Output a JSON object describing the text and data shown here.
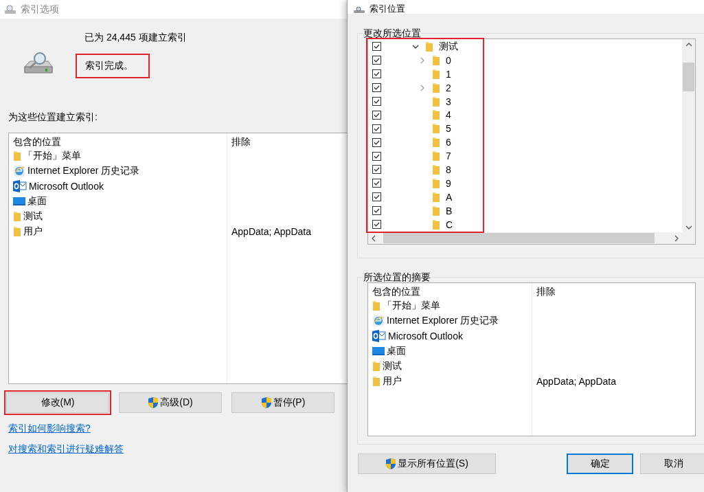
{
  "left_window": {
    "title": "索引选项",
    "indexed_count": "已为 24,445 项建立索引",
    "status": {
      "text": "索引完成。",
      "highlighted": true
    },
    "locations_label": "为这些位置建立索引:",
    "table": {
      "columns": [
        "包含的位置",
        "排除"
      ],
      "rows": [
        {
          "kind": "folder",
          "location": "「开始」菜单"
        },
        {
          "kind": "browser",
          "location": "Internet Explorer 历史记录"
        },
        {
          "kind": "mail",
          "location": "Microsoft Outlook"
        },
        {
          "kind": "desktop",
          "location": "桌面"
        },
        {
          "kind": "folder",
          "location": "测试"
        },
        {
          "kind": "folder",
          "location": "用户",
          "exclude": "AppData; AppData"
        }
      ]
    },
    "buttons": [
      {
        "label": "修改(M)",
        "shield": false,
        "highlighted": true
      },
      {
        "label": "高级(D)",
        "shield": true,
        "highlighted": false
      },
      {
        "label": "暂停(P)",
        "shield": true,
        "highlighted": false
      }
    ],
    "links": [
      "索引如何影响搜索?",
      "对搜索和索引进行疑难解答"
    ]
  },
  "right_window": {
    "title": "索引位置",
    "change_group": {
      "title": "更改所选位置",
      "highlighted": true,
      "tree": [
        {
          "label": "测试",
          "checked": true,
          "expandable": true,
          "expanded": true,
          "children": [
            {
              "label": "0",
              "checked": true,
              "expandable": true,
              "expanded": false
            },
            {
              "label": "1",
              "checked": true,
              "expandable": false,
              "expanded": false
            },
            {
              "label": "2",
              "checked": true,
              "expandable": true,
              "expanded": false
            },
            {
              "label": "3",
              "checked": true,
              "expandable": false,
              "expanded": false
            },
            {
              "label": "4",
              "checked": true,
              "expandable": false,
              "expanded": false
            },
            {
              "label": "5",
              "checked": true,
              "expandable": false,
              "expanded": false
            },
            {
              "label": "6",
              "checked": true,
              "expandable": false,
              "expanded": false
            },
            {
              "label": "7",
              "checked": true,
              "expandable": false,
              "expanded": false
            },
            {
              "label": "8",
              "checked": true,
              "expandable": false,
              "expanded": false
            },
            {
              "label": "9",
              "checked": true,
              "expandable": false,
              "expanded": false
            },
            {
              "label": "A",
              "checked": true,
              "expandable": false,
              "expanded": false
            },
            {
              "label": "B",
              "checked": true,
              "expandable": false,
              "expanded": false
            },
            {
              "label": "C",
              "checked": true,
              "expandable": false,
              "expanded": false
            }
          ]
        }
      ]
    },
    "summary_group": {
      "title": "所选位置的摘要",
      "table": {
        "columns": [
          "包含的位置",
          "排除"
        ],
        "rows": [
          {
            "kind": "folder",
            "location": "「开始」菜单"
          },
          {
            "kind": "browser",
            "location": "Internet Explorer 历史记录"
          },
          {
            "kind": "mail",
            "location": "Microsoft Outlook"
          },
          {
            "kind": "desktop",
            "location": "桌面"
          },
          {
            "kind": "folder",
            "location": "测试"
          },
          {
            "kind": "folder",
            "location": "用户",
            "exclude": "AppData; AppData"
          }
        ]
      }
    },
    "buttons": [
      {
        "label": "显示所有位置(S)",
        "shield": true,
        "default": false
      },
      {
        "label": "确定",
        "shield": false,
        "default": true
      },
      {
        "label": "取消",
        "shield": false,
        "default": false
      }
    ]
  }
}
